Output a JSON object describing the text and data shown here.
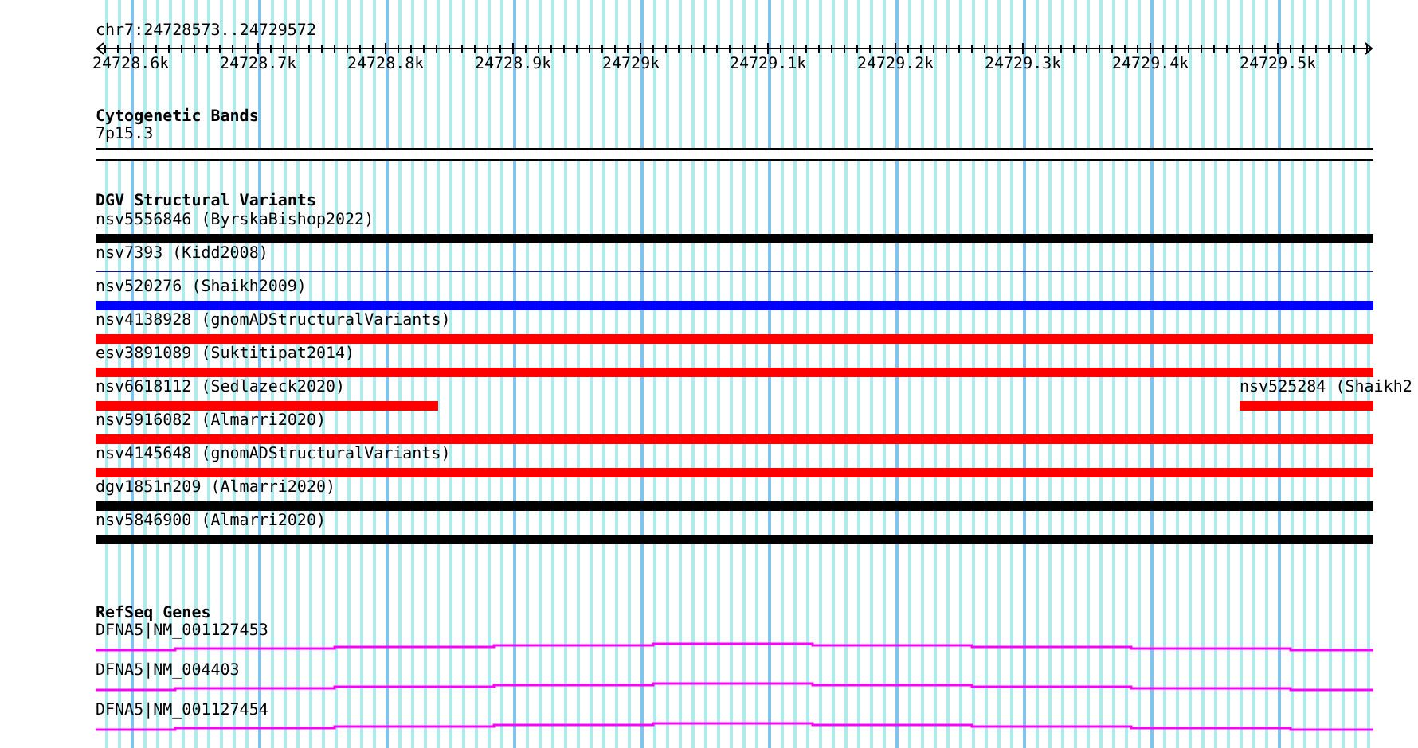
{
  "ruler": {
    "location": "chr7:24728573..24729572",
    "ticks": [
      "24728.6k",
      "24728.7k",
      "24728.8k",
      "24728.9k",
      "24729k",
      "24729.1k",
      "24729.2k",
      "24729.3k",
      "24729.4k",
      "24729.5k"
    ]
  },
  "cytogenetic_bands": {
    "title": "Cytogenetic Bands",
    "bands": [
      {
        "label": "7p15.3"
      }
    ]
  },
  "dgv_structural_variants": {
    "title": "DGV Structural Variants",
    "rows": [
      {
        "features": [
          {
            "label": "nsv5556846 (ByrskaBishop2022)",
            "kind": "full",
            "color": "#000000"
          }
        ]
      },
      {
        "features": [
          {
            "label": "nsv7393 (Kidd2008)",
            "kind": "thin",
            "color": "#191970"
          }
        ]
      },
      {
        "features": [
          {
            "label": "nsv520276 (Shaikh2009)",
            "kind": "full",
            "color": "#0000ff"
          }
        ]
      },
      {
        "features": [
          {
            "label": "nsv4138928 (gnomADStructuralVariants)",
            "kind": "full",
            "color": "#ff0000"
          }
        ]
      },
      {
        "features": [
          {
            "label": "esv3891089 (Suktitipat2014)",
            "kind": "full",
            "color": "#ff0000"
          }
        ]
      },
      {
        "features": [
          {
            "label": "nsv6618112 (Sedlazeck2020)",
            "kind": "start",
            "color": "#ff0000"
          },
          {
            "label": "nsv525284 (Shaikh2",
            "kind": "end",
            "color": "#ff0000"
          }
        ]
      },
      {
        "features": [
          {
            "label": "nsv5916082 (Almarri2020)",
            "kind": "full",
            "color": "#ff0000"
          }
        ]
      },
      {
        "features": [
          {
            "label": "nsv4145648 (gnomADStructuralVariants)",
            "kind": "full",
            "color": "#ff0000"
          }
        ]
      },
      {
        "features": [
          {
            "label": "dgv1851n209 (Almarri2020)",
            "kind": "full",
            "color": "#000000"
          }
        ]
      },
      {
        "features": [
          {
            "label": "nsv5846900 (Almarri2020)",
            "kind": "full",
            "color": "#000000"
          }
        ]
      }
    ]
  },
  "refseq_genes": {
    "title": "RefSeq Genes",
    "genes": [
      {
        "label": "DFNA5|NM_001127453"
      },
      {
        "label": "DFNA5|NM_004403"
      },
      {
        "label": "DFNA5|NM_001127454"
      }
    ]
  }
}
